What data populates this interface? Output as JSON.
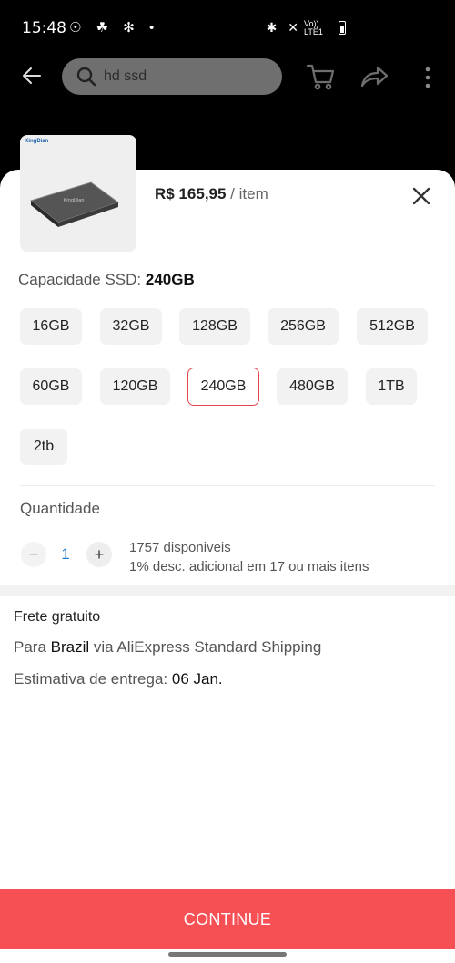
{
  "status_bar": {
    "time": "15:48",
    "left_icons": "☉ ☘ ✻ •",
    "right_icons": "✱ ✕",
    "network_label": "Vo)) LTE1"
  },
  "search": {
    "placeholder": "hd ssd"
  },
  "product": {
    "thumb_brand": "KingDian",
    "price": "R$ 165,95",
    "price_unit": " / item"
  },
  "capacity": {
    "label": "Capacidade SSD: ",
    "selected": "240GB",
    "options": [
      "16GB",
      "32GB",
      "128GB",
      "256GB",
      "512GB",
      "60GB",
      "120GB",
      "240GB",
      "480GB",
      "1TB",
      "2tb"
    ]
  },
  "quantity": {
    "title": "Quantidade",
    "minus": "−",
    "value": "1",
    "plus": "+",
    "available": "1757 disponiveis",
    "discount": "1% desc. adicional em 17 ou mais itens"
  },
  "shipping": {
    "free": "Frete gratuito",
    "to_prefix": "Para ",
    "country": "Brazil",
    "via": " via AliExpress Standard Shipping",
    "delivery_prefix": "Estimativa de entrega: ",
    "delivery_date": "06 Jan."
  },
  "continue_label": "CONTINUE"
}
